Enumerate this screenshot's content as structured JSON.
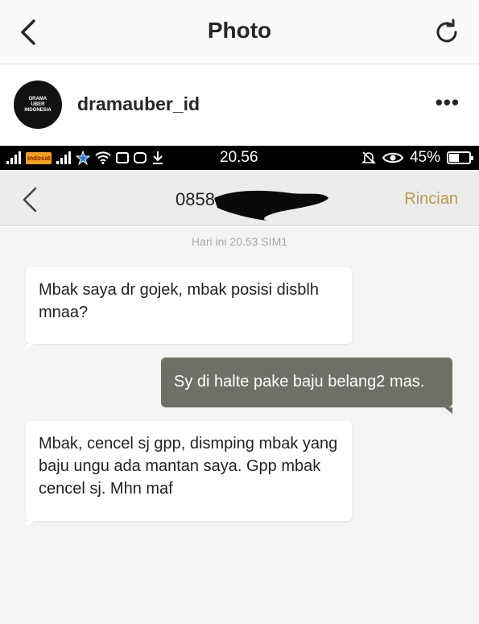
{
  "instagram": {
    "title": "Photo",
    "username": "dramauber_id",
    "avatar_text": [
      "DRAMA",
      "UBER",
      "INDONESIA"
    ],
    "more_label": "•••",
    "icons": {
      "back": "chevron-left-icon",
      "refresh": "refresh-icon"
    }
  },
  "statusbar": {
    "time": "20.56",
    "battery": "45%",
    "operator_badge": "indosat",
    "icons": [
      "signal-icon",
      "operator-icon",
      "signal-icon",
      "star-icon",
      "wifi-icon",
      "bbm-icon",
      "instagram-icon",
      "download-icon",
      "mute-icon",
      "eye-icon",
      "battery-icon"
    ]
  },
  "sms": {
    "contact": "0858",
    "details_label": "Rincian",
    "date_line": "Hari ini  20.53  SIM1",
    "messages": [
      {
        "direction": "incoming",
        "text": "Mbak saya dr gojek, mbak posisi disblh mnaa?"
      },
      {
        "direction": "outgoing",
        "text": "Sy di halte pake baju belang2 mas."
      },
      {
        "direction": "incoming",
        "text": "Mbak, cencel sj gpp, dismping mbak yang baju ungu ada mantan saya. Gpp mbak cencel sj. Mhn maf"
      }
    ]
  },
  "colors": {
    "incoming_bubble": "#ffffff",
    "outgoing_bubble": "#6f6f66",
    "details_accent": "#b59a4a",
    "chat_background": "#f4f4f4"
  }
}
